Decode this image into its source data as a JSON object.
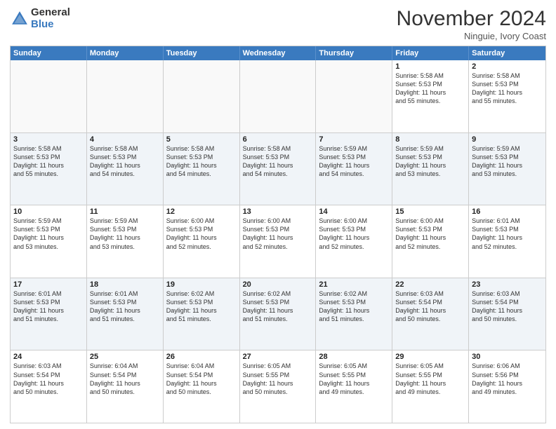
{
  "logo": {
    "general": "General",
    "blue": "Blue"
  },
  "header": {
    "month": "November 2024",
    "location": "Ninguie, Ivory Coast"
  },
  "weekdays": [
    "Sunday",
    "Monday",
    "Tuesday",
    "Wednesday",
    "Thursday",
    "Friday",
    "Saturday"
  ],
  "weeks": [
    [
      {
        "day": "",
        "info": ""
      },
      {
        "day": "",
        "info": ""
      },
      {
        "day": "",
        "info": ""
      },
      {
        "day": "",
        "info": ""
      },
      {
        "day": "",
        "info": ""
      },
      {
        "day": "1",
        "info": "Sunrise: 5:58 AM\nSunset: 5:53 PM\nDaylight: 11 hours\nand 55 minutes."
      },
      {
        "day": "2",
        "info": "Sunrise: 5:58 AM\nSunset: 5:53 PM\nDaylight: 11 hours\nand 55 minutes."
      }
    ],
    [
      {
        "day": "3",
        "info": "Sunrise: 5:58 AM\nSunset: 5:53 PM\nDaylight: 11 hours\nand 55 minutes."
      },
      {
        "day": "4",
        "info": "Sunrise: 5:58 AM\nSunset: 5:53 PM\nDaylight: 11 hours\nand 54 minutes."
      },
      {
        "day": "5",
        "info": "Sunrise: 5:58 AM\nSunset: 5:53 PM\nDaylight: 11 hours\nand 54 minutes."
      },
      {
        "day": "6",
        "info": "Sunrise: 5:58 AM\nSunset: 5:53 PM\nDaylight: 11 hours\nand 54 minutes."
      },
      {
        "day": "7",
        "info": "Sunrise: 5:59 AM\nSunset: 5:53 PM\nDaylight: 11 hours\nand 54 minutes."
      },
      {
        "day": "8",
        "info": "Sunrise: 5:59 AM\nSunset: 5:53 PM\nDaylight: 11 hours\nand 53 minutes."
      },
      {
        "day": "9",
        "info": "Sunrise: 5:59 AM\nSunset: 5:53 PM\nDaylight: 11 hours\nand 53 minutes."
      }
    ],
    [
      {
        "day": "10",
        "info": "Sunrise: 5:59 AM\nSunset: 5:53 PM\nDaylight: 11 hours\nand 53 minutes."
      },
      {
        "day": "11",
        "info": "Sunrise: 5:59 AM\nSunset: 5:53 PM\nDaylight: 11 hours\nand 53 minutes."
      },
      {
        "day": "12",
        "info": "Sunrise: 6:00 AM\nSunset: 5:53 PM\nDaylight: 11 hours\nand 52 minutes."
      },
      {
        "day": "13",
        "info": "Sunrise: 6:00 AM\nSunset: 5:53 PM\nDaylight: 11 hours\nand 52 minutes."
      },
      {
        "day": "14",
        "info": "Sunrise: 6:00 AM\nSunset: 5:53 PM\nDaylight: 11 hours\nand 52 minutes."
      },
      {
        "day": "15",
        "info": "Sunrise: 6:00 AM\nSunset: 5:53 PM\nDaylight: 11 hours\nand 52 minutes."
      },
      {
        "day": "16",
        "info": "Sunrise: 6:01 AM\nSunset: 5:53 PM\nDaylight: 11 hours\nand 52 minutes."
      }
    ],
    [
      {
        "day": "17",
        "info": "Sunrise: 6:01 AM\nSunset: 5:53 PM\nDaylight: 11 hours\nand 51 minutes."
      },
      {
        "day": "18",
        "info": "Sunrise: 6:01 AM\nSunset: 5:53 PM\nDaylight: 11 hours\nand 51 minutes."
      },
      {
        "day": "19",
        "info": "Sunrise: 6:02 AM\nSunset: 5:53 PM\nDaylight: 11 hours\nand 51 minutes."
      },
      {
        "day": "20",
        "info": "Sunrise: 6:02 AM\nSunset: 5:53 PM\nDaylight: 11 hours\nand 51 minutes."
      },
      {
        "day": "21",
        "info": "Sunrise: 6:02 AM\nSunset: 5:53 PM\nDaylight: 11 hours\nand 51 minutes."
      },
      {
        "day": "22",
        "info": "Sunrise: 6:03 AM\nSunset: 5:54 PM\nDaylight: 11 hours\nand 50 minutes."
      },
      {
        "day": "23",
        "info": "Sunrise: 6:03 AM\nSunset: 5:54 PM\nDaylight: 11 hours\nand 50 minutes."
      }
    ],
    [
      {
        "day": "24",
        "info": "Sunrise: 6:03 AM\nSunset: 5:54 PM\nDaylight: 11 hours\nand 50 minutes."
      },
      {
        "day": "25",
        "info": "Sunrise: 6:04 AM\nSunset: 5:54 PM\nDaylight: 11 hours\nand 50 minutes."
      },
      {
        "day": "26",
        "info": "Sunrise: 6:04 AM\nSunset: 5:54 PM\nDaylight: 11 hours\nand 50 minutes."
      },
      {
        "day": "27",
        "info": "Sunrise: 6:05 AM\nSunset: 5:55 PM\nDaylight: 11 hours\nand 50 minutes."
      },
      {
        "day": "28",
        "info": "Sunrise: 6:05 AM\nSunset: 5:55 PM\nDaylight: 11 hours\nand 49 minutes."
      },
      {
        "day": "29",
        "info": "Sunrise: 6:05 AM\nSunset: 5:55 PM\nDaylight: 11 hours\nand 49 minutes."
      },
      {
        "day": "30",
        "info": "Sunrise: 6:06 AM\nSunset: 5:56 PM\nDaylight: 11 hours\nand 49 minutes."
      }
    ]
  ]
}
